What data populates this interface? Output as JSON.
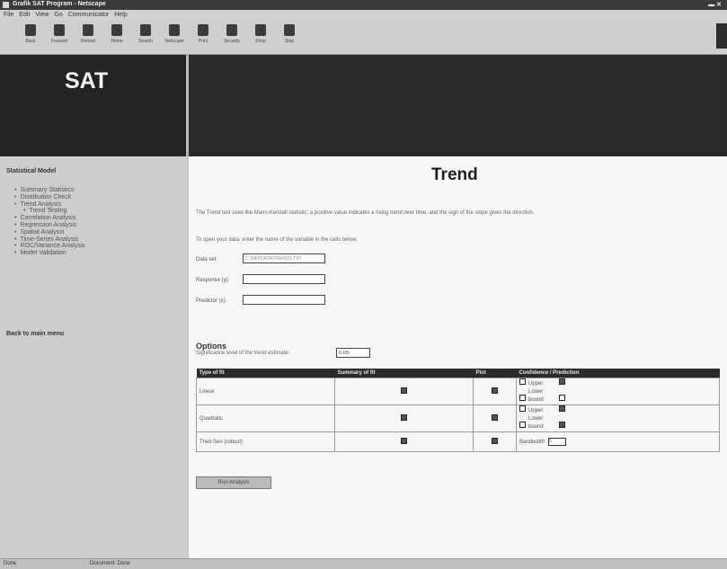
{
  "window": {
    "title": "Grafik SAT Program - Netscape",
    "controls": "▬ ✕"
  },
  "menu": [
    "File",
    "Edit",
    "View",
    "Go",
    "Communicator",
    "Help"
  ],
  "toolbar": {
    "buttons": [
      {
        "label": "Back",
        "icon": "back-icon"
      },
      {
        "label": "Forward",
        "icon": "forward-icon"
      },
      {
        "label": "Reload",
        "icon": "reload-icon"
      },
      {
        "label": "Home",
        "icon": "home-icon"
      },
      {
        "label": "Search",
        "icon": "search-icon"
      },
      {
        "label": "Netscape",
        "icon": "netscape-icon"
      },
      {
        "label": "Print",
        "icon": "print-icon"
      },
      {
        "label": "Security",
        "icon": "lock-icon"
      },
      {
        "label": "Shop",
        "icon": "shop-icon"
      },
      {
        "label": "Stop",
        "icon": "stop-icon"
      }
    ]
  },
  "brand": "SAT",
  "sidebar": {
    "heading": "Statistical Model",
    "items": [
      {
        "label": "Summary Statistics",
        "sub": false
      },
      {
        "label": "Distribution Check",
        "sub": false
      },
      {
        "label": "Trend Analysis",
        "sub": false
      },
      {
        "label": "Trend Testing",
        "sub": true
      },
      {
        "label": "Correlation Analysis",
        "sub": false
      },
      {
        "label": "Regression Analysis",
        "sub": false
      },
      {
        "label": "Spatial Analysis",
        "sub": false
      },
      {
        "label": "Time-Series Analysis",
        "sub": false
      },
      {
        "label": "ROC/Variance Analysis",
        "sub": false
      },
      {
        "label": "Model Validation",
        "sub": false
      }
    ],
    "footer": "Back to main menu"
  },
  "main": {
    "title": "Trend",
    "intro": "The Trend test uses the Mann-Kendall statistic; a positive value indicates a rising trend over time, and the sign of the slope gives the direction.",
    "instruction": "To open your data, enter the name of the variable in the cells below.",
    "fields": [
      {
        "label": "Data set:",
        "value": "C:\\SAT\\DATA\\TRENDS.TXT"
      },
      {
        "label": "Response (y):",
        "value": ""
      },
      {
        "label": "Predictor (x):",
        "value": ""
      }
    ],
    "options_heading": "Options",
    "significance_label": "Significance level of the trend estimate:",
    "significance_value": "0.05",
    "table": {
      "headers": [
        "Type of fit",
        "Summary of fit",
        "Plot",
        "Confidence / Prediction"
      ],
      "rows": [
        {
          "name": "Linear",
          "summary": true,
          "plot": true,
          "opts": [
            {
              "label": "Upper",
              "checked": true
            },
            {
              "label": "Lower bound",
              "checked": false
            }
          ]
        },
        {
          "name": "Quadratic",
          "summary": true,
          "plot": true,
          "opts": [
            {
              "label": "Upper",
              "checked": true
            },
            {
              "label": "Lower bound",
              "checked": true
            }
          ]
        },
        {
          "name": "Theil-Sen (robust)",
          "summary": true,
          "plot": true,
          "select_label": "Bandwidth",
          "select_value": "5"
        }
      ]
    },
    "run_button": "Run Analysis"
  },
  "status": {
    "left": "Done",
    "mid": "Document: Done"
  },
  "colors": {
    "banner": "#232323",
    "sidebar": "#cdcdcd",
    "table_header": "#2b2b2b"
  }
}
